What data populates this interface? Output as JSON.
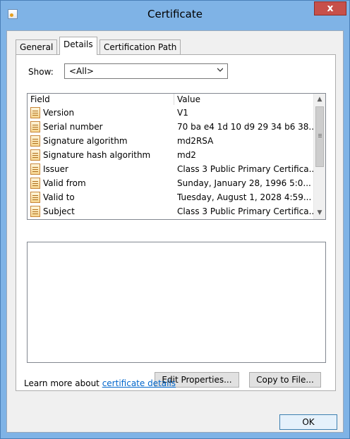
{
  "window": {
    "title": "Certificate",
    "close_label": "x"
  },
  "tabs": [
    {
      "label": "General"
    },
    {
      "label": "Details"
    },
    {
      "label": "Certification Path"
    }
  ],
  "show": {
    "label": "Show:",
    "selected": "<All>"
  },
  "list": {
    "headers": {
      "field": "Field",
      "value": "Value"
    },
    "rows": [
      {
        "field": "Version",
        "value": "V1"
      },
      {
        "field": "Serial number",
        "value": "70 ba e4 1d 10 d9 29 34 b6 38..."
      },
      {
        "field": "Signature algorithm",
        "value": "md2RSA"
      },
      {
        "field": "Signature hash algorithm",
        "value": "md2"
      },
      {
        "field": "Issuer",
        "value": "Class 3 Public Primary Certifica..."
      },
      {
        "field": "Valid from",
        "value": "Sunday, January 28, 1996 5:0..."
      },
      {
        "field": "Valid to",
        "value": "Tuesday, August 1, 2028 4:59..."
      },
      {
        "field": "Subject",
        "value": "Class 3 Public Primary Certifica..."
      }
    ]
  },
  "buttons": {
    "edit_properties": "Edit Properties...",
    "copy_to_file": "Copy to File...",
    "ok": "OK"
  },
  "learn_more": {
    "prefix": "Learn more about ",
    "link": "certificate details"
  },
  "icons": {
    "title_icon": "certificate-icon",
    "field_icon": "field-document-icon"
  },
  "colors": {
    "titlebar": "#7fb3e6",
    "close": "#c7504a",
    "link": "#0066cc"
  }
}
